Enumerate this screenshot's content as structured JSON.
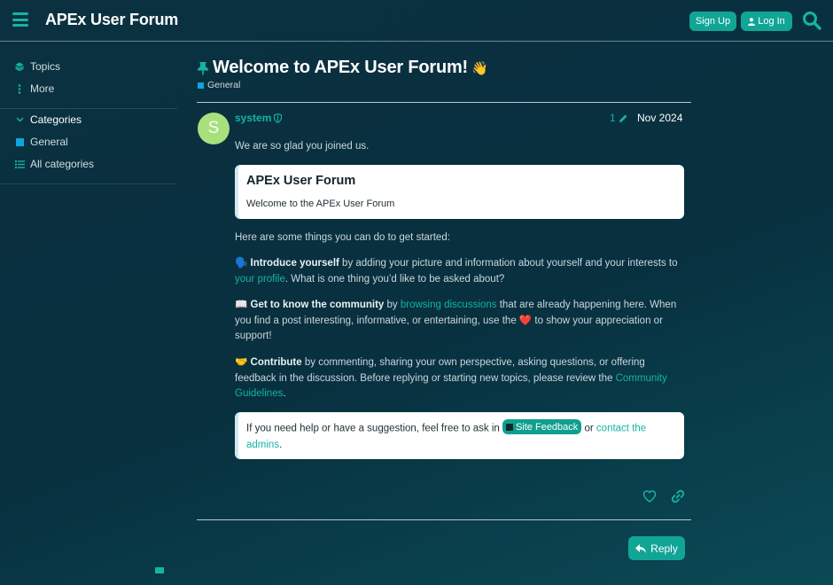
{
  "header": {
    "site_title": "APEx User Forum",
    "signup_label": "Sign Up",
    "login_label": "Log In"
  },
  "sidebar": {
    "topics": "Topics",
    "more": "More",
    "categories_header": "Categories",
    "category_general": "General",
    "all_categories": "All categories"
  },
  "topic": {
    "title": "Welcome to APEx User Forum!",
    "wave_emoji": "👋",
    "category": "General"
  },
  "post": {
    "author": "system",
    "avatar_letter": "S",
    "edit_count": "1",
    "date": "Nov 2024",
    "greeting": "We are so glad you joined us.",
    "onebox_title": "APEx User Forum",
    "onebox_desc": "Welcome to the APEx User Forum",
    "started_intro": "Here are some things you can do to get started:",
    "intro_emoji": "🗣️",
    "intro_bold": "Introduce yourself",
    "intro_text1": " by adding your picture and information about yourself and your interests to ",
    "intro_link": "your profile",
    "intro_text2": ". What is one thing you’d like to be asked about?",
    "know_emoji": "📖",
    "know_bold": "Get to know the community",
    "know_text1": " by ",
    "know_link": "browsing discussions",
    "know_text2": " that are already happening here. When you find a post interesting, informative, or entertaining, use the ",
    "know_heart": "❤️",
    "know_text3": " to show your appreciation or support!",
    "contrib_emoji": "🤝",
    "contrib_bold": "Contribute",
    "contrib_text": " by commenting, sharing your own perspective, asking questions, or offering feedback in the discussion. Before replying or starting new topics, please review the ",
    "contrib_link": "Community Guidelines",
    "contrib_end": ".",
    "help_text1": "If you need help or have a suggestion, feel free to ask in ",
    "help_badge": "Site Feedback",
    "help_text2": " or ",
    "help_link": "contact the admins",
    "help_end": "."
  },
  "actions": {
    "reply_label": "Reply"
  },
  "colors": {
    "accent": "#11a596",
    "link": "#15b3a1",
    "category_general": "#0ea5e0",
    "avatar": "#a9e07e",
    "background": "#0b3140"
  }
}
